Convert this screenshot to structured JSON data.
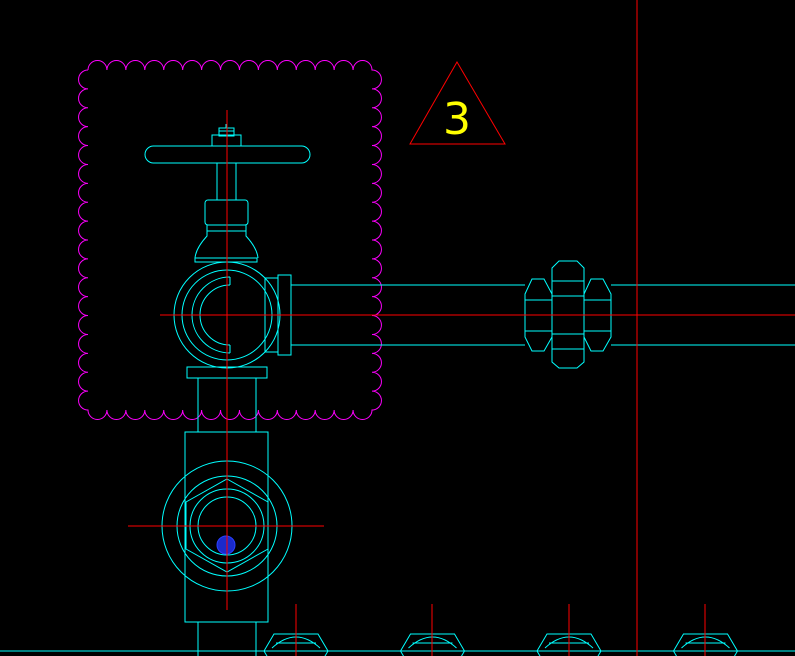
{
  "drawing": {
    "background": "#000000",
    "colors": {
      "pipe_linework": "#00ffff",
      "centerlines": "#ff0000",
      "revision_cloud": "#ff00ff",
      "revision_triangle": "#ff0000",
      "revision_label": "#ffff00",
      "marker_dot": "#1a2acc"
    },
    "revision_tag": {
      "label": "3",
      "shape": "triangle"
    },
    "components": [
      {
        "name": "globe-valve",
        "symbol": "handwheel-valve"
      },
      {
        "name": "union-fitting",
        "symbol": "hex-union"
      },
      {
        "name": "tee-fitting",
        "symbol": "hex-plug"
      },
      {
        "name": "bottom-fittings",
        "count": 4
      }
    ]
  }
}
